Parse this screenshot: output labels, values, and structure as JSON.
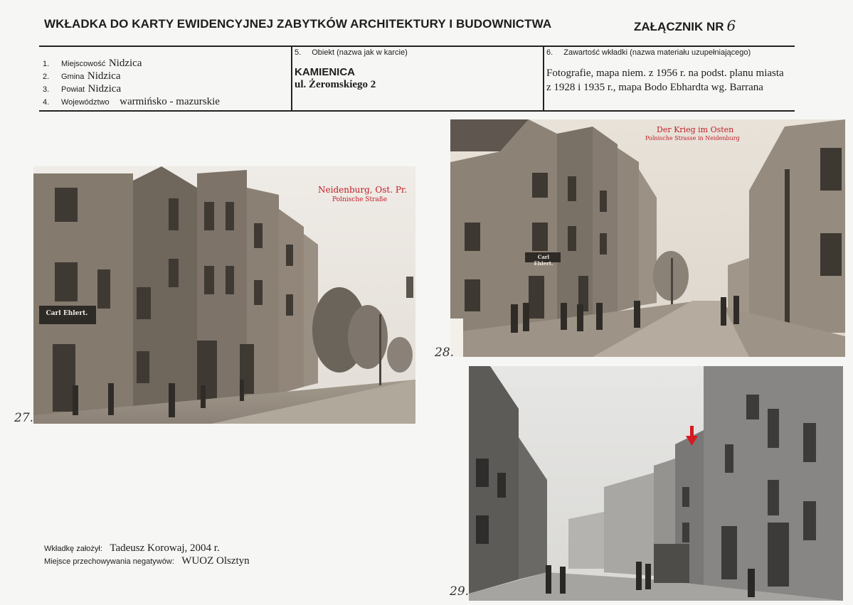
{
  "header": {
    "title": "WKŁADKA DO KARTY EWIDENCYJNEJ ZABYTKÓW ARCHITEKTURY I BUDOWNICTWA",
    "annex_label": "ZAŁĄCZNIK NR",
    "annex_number": "6"
  },
  "location": {
    "items": [
      {
        "num": "1.",
        "label": "Miejscowość",
        "value": "Nidzica"
      },
      {
        "num": "2.",
        "label": "Gmina",
        "value": "Nidzica"
      },
      {
        "num": "3.",
        "label": "Powiat",
        "value": "Nidzica"
      },
      {
        "num": "4.",
        "label": "Województwo",
        "value": "warmińsko - mazurskie"
      }
    ]
  },
  "object": {
    "num": "5.",
    "label": "Obiekt (nazwa jak w karcie)",
    "name": "KAMIENICA",
    "address": "ul. Żeromskiego 2"
  },
  "contents": {
    "num": "6.",
    "label": "Zawartość wkładki (nazwa materiału uzupełniającego)",
    "line1": "Fotografie, mapa niem. z 1956 r. na podst. planu miasta",
    "line2": "z 1928 i 1935 r., mapa Bodo Ebhardta wg. Barrana"
  },
  "photos": [
    {
      "number": "27.",
      "caption_title": "Neidenburg, Ost. Pr.",
      "caption_sub": "Polnische Straße",
      "sign1": "Carl Ehlert."
    },
    {
      "number": "28.",
      "caption_title": "Der Krieg im Osten",
      "caption_sub": "Polnische Strasse in Neidenburg",
      "sign1": "Carl Ehlert."
    },
    {
      "number": "29."
    }
  ],
  "footer": {
    "author_label": "Wkładkę założył:",
    "author_value": "Tadeusz Korowaj, 2004 r.",
    "storage_label": "Miejsce przechowywania negatywów:",
    "storage_value": "WUOZ Olsztyn"
  },
  "colors": {
    "paper": "#f6f6f4",
    "photo_tint": "#7a6d5e",
    "caption_red": "#c2202a",
    "arrow_red": "#d51a22"
  }
}
